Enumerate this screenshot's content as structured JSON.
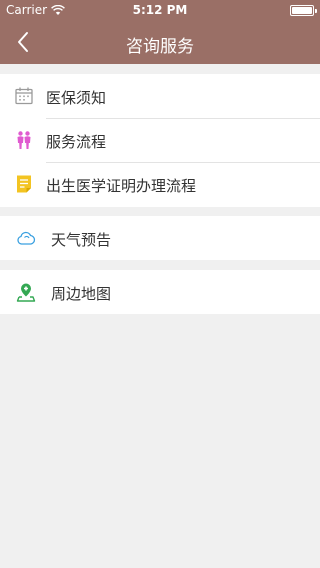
{
  "status": {
    "carrier": "Carrier",
    "time": "5:12 PM"
  },
  "nav": {
    "title": "咨询服务",
    "back_icon": "chevron-left-icon"
  },
  "colors": {
    "header": "#9a6f66",
    "background": "#f0f0f0",
    "pink_icon": "#e05bd0",
    "yellow_icon": "#f3c422",
    "blue_icon": "#3aa0e0",
    "green_icon": "#34a853"
  },
  "sections": [
    {
      "items": [
        {
          "label": "医保须知",
          "icon": "calendar-icon"
        },
        {
          "label": "服务流程",
          "icon": "people-icon"
        },
        {
          "label": "出生医学证明办理流程",
          "icon": "note-icon"
        }
      ]
    },
    {
      "items": [
        {
          "label": "天气预告",
          "icon": "cloud-icon"
        }
      ]
    },
    {
      "items": [
        {
          "label": "周边地图",
          "icon": "map-pin-icon"
        }
      ]
    }
  ]
}
